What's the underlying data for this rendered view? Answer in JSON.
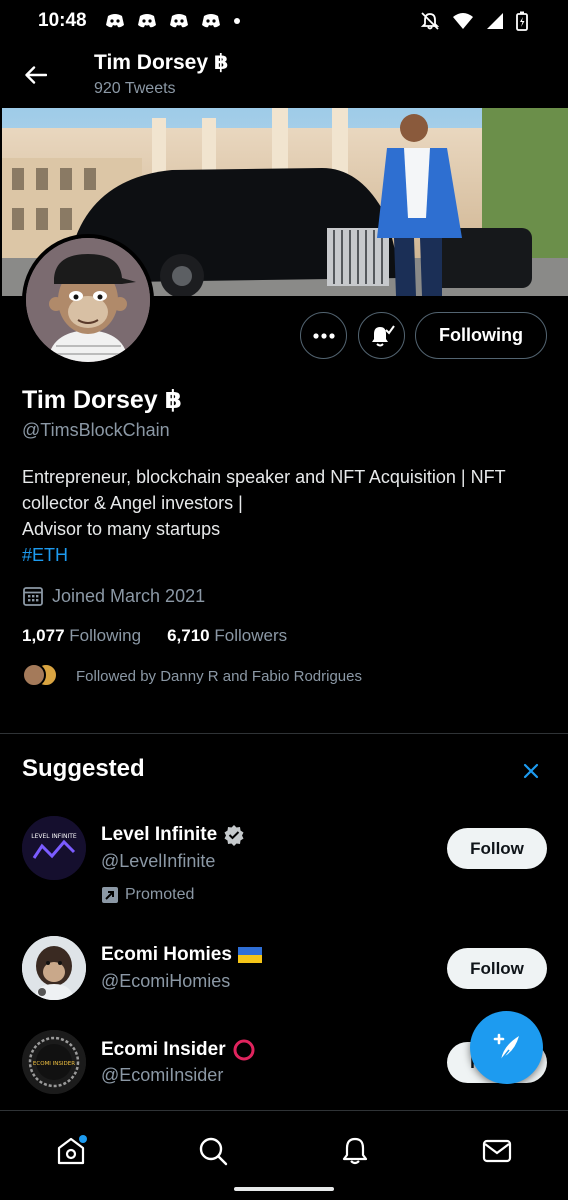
{
  "status_bar": {
    "time": "10:48"
  },
  "header": {
    "name": "Tim Dorsey ฿",
    "tweet_count": "920 Tweets"
  },
  "profile": {
    "name": "Tim Dorsey ฿",
    "handle": "@TimsBlockChain",
    "bio_line1": "Entrepreneur, blockchain speaker and NFT Acquisition | NFT collector & Angel investors |",
    "bio_line2": "Advisor to many startups",
    "bio_hashtag": "#ETH",
    "joined": "Joined March 2021",
    "following_count": "1,077",
    "following_label": "Following",
    "followers_count": "6,710",
    "followers_label": "Followers",
    "followed_by": "Followed by Danny R and Fabio Rodrigues",
    "following_button": "Following"
  },
  "suggested": {
    "title": "Suggested",
    "items": [
      {
        "name": "Level Infinite",
        "handle": "@LevelInfinite",
        "button": "Follow",
        "promoted": "Promoted",
        "avatar_text": "LEVEL INFINITE"
      },
      {
        "name": "Ecomi Homies",
        "handle": "@EcomiHomies",
        "button": "Follow"
      },
      {
        "name": "Ecomi Insider",
        "handle": "@EcomiInsider",
        "button": "Follow",
        "avatar_text": "ECOMI INSIDER"
      }
    ]
  },
  "colors": {
    "accent": "#1d9bf0",
    "background": "#000000",
    "secondary_text": "#8b98a5"
  }
}
